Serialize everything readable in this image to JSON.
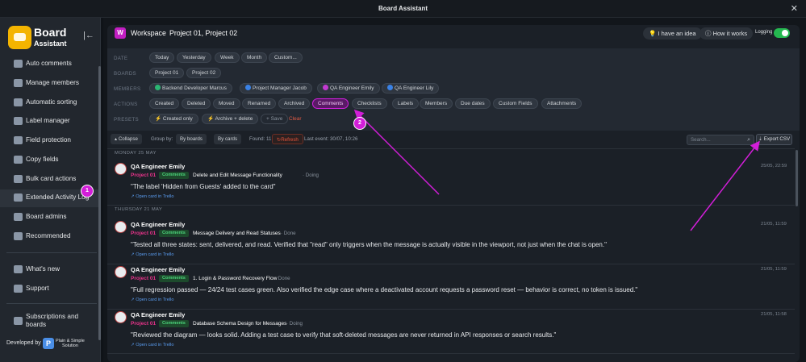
{
  "window": {
    "title": "Board Assistant"
  },
  "app": {
    "name_line1": "Board",
    "name_line2": "Assistant"
  },
  "sidebar": {
    "items": [
      {
        "label": "Auto comments",
        "icon": "comment-icon"
      },
      {
        "label": "Manage members",
        "icon": "users-icon"
      },
      {
        "label": "Automatic sorting",
        "icon": "sort-icon"
      },
      {
        "label": "Label manager",
        "icon": "label-icon"
      },
      {
        "label": "Field protection",
        "icon": "lock-icon"
      },
      {
        "label": "Copy fields",
        "icon": "copy-icon"
      },
      {
        "label": "Bulk card actions",
        "icon": "cursor-icon"
      },
      {
        "label": "Extended Activity Log",
        "icon": "log-icon",
        "active": true
      },
      {
        "label": "Board admins",
        "icon": "admin-icon"
      },
      {
        "label": "Recommended",
        "icon": "heart-icon"
      }
    ],
    "whats_new": "What's new",
    "support": "Support",
    "subscriptions_line1": "Subscriptions and",
    "subscriptions_line2": "boards",
    "developed_by": "Developed by",
    "dev_line1": "Plain & Simple",
    "dev_line2": "Solution"
  },
  "workspace": {
    "icon_letter": "W",
    "label": "Workspace",
    "projects": "Project 01, Project 02",
    "idea_button": "I have an idea",
    "how_button": "How it works",
    "logging_label": "Logging",
    "logging_on": true
  },
  "filters": {
    "date_label": "DATE",
    "date_chips": [
      "Today",
      "Yesterday",
      "Week",
      "Month",
      "Custom..."
    ],
    "boards_label": "BOARDS",
    "board_chips": [
      "Project 01",
      "Project 02"
    ],
    "members_label": "MEMBERS",
    "member_chips": [
      {
        "name": "Backend Developer Marcus",
        "color": "#2bb673"
      },
      {
        "name": "Project Manager Jacob",
        "color": "#3a82e6"
      },
      {
        "name": "QA Engineer Emily",
        "color": "#c23ad1"
      },
      {
        "name": "QA Engineer Lily",
        "color": "#3a82e6"
      }
    ],
    "actions_label": "ACTIONS",
    "action_chips": [
      "Created",
      "Deleted",
      "Moved",
      "Renamed",
      "Archived",
      "Comments",
      "Checklists",
      "Labels",
      "Members",
      "Due dates",
      "Custom Fields",
      "Attachments"
    ],
    "selected_action": "Comments",
    "presets_label": "PRESETS",
    "preset_chips": [
      "Created only",
      "Archive + delete"
    ],
    "save_label": "+ Save",
    "clear_label": "Clear"
  },
  "toolbar": {
    "collapse": "Collapse",
    "group_by_label": "Group by:",
    "by_boards": "By boards",
    "by_cards": "By cards",
    "found": "Found: 11",
    "refresh": "Refresh",
    "last_event": "Last event: 30/07, 10:26",
    "search_placeholder": "Search...",
    "export": "Export CSV"
  },
  "feed": {
    "day1": "MONDAY 25 MAY",
    "day2": "THURSDAY 21 MAY",
    "link_text": "↗ Open card in Trello",
    "entries": [
      {
        "user": "QA Engineer Emily",
        "project": "Project 01",
        "tag": "Comments",
        "card": "Delete and Edit Message Functionality",
        "status": "· Doing",
        "text": "\"The label 'Hidden from Guests' added to the card\"",
        "time": "25/05, 22:59"
      },
      {
        "user": "QA Engineer Emily",
        "project": "Project 01",
        "tag": "Comments",
        "card": "Message Delivery and Read Statuses",
        "status": "· Done",
        "text": "\"Tested all three states: sent, delivered, and read. Verified that \"read\" only triggers when the message is actually visible in the viewport, not just when the chat is open.\"",
        "time": "21/05, 11:59"
      },
      {
        "user": "QA Engineer Emily",
        "project": "Project 01",
        "tag": "Comments",
        "card": "1. Login & Password Recovery Flow",
        "status": "· Done",
        "text": "\"Full regression passed — 24/24 test cases green. Also verified the edge case where a deactivated account requests a password reset — behavior is correct, no token is issued.\"",
        "time": "21/05, 11:59"
      },
      {
        "user": "QA Engineer Emily",
        "project": "Project 01",
        "tag": "Comments",
        "card": "Database Schema Design for Messages",
        "status": "· Doing",
        "text": "\"Reviewed the diagram — looks solid. Adding a test case to verify that soft-deleted messages are never returned in API responses or search results.\"",
        "time": "21/05, 11:58"
      }
    ]
  },
  "annotations": {
    "badge1": "1",
    "badge2": "2"
  },
  "colors": {
    "accent": "#d21ed8",
    "logo": "#f4b400",
    "toggle": "#25b850",
    "project": "#e8338a",
    "tag": "#4cd17a"
  }
}
